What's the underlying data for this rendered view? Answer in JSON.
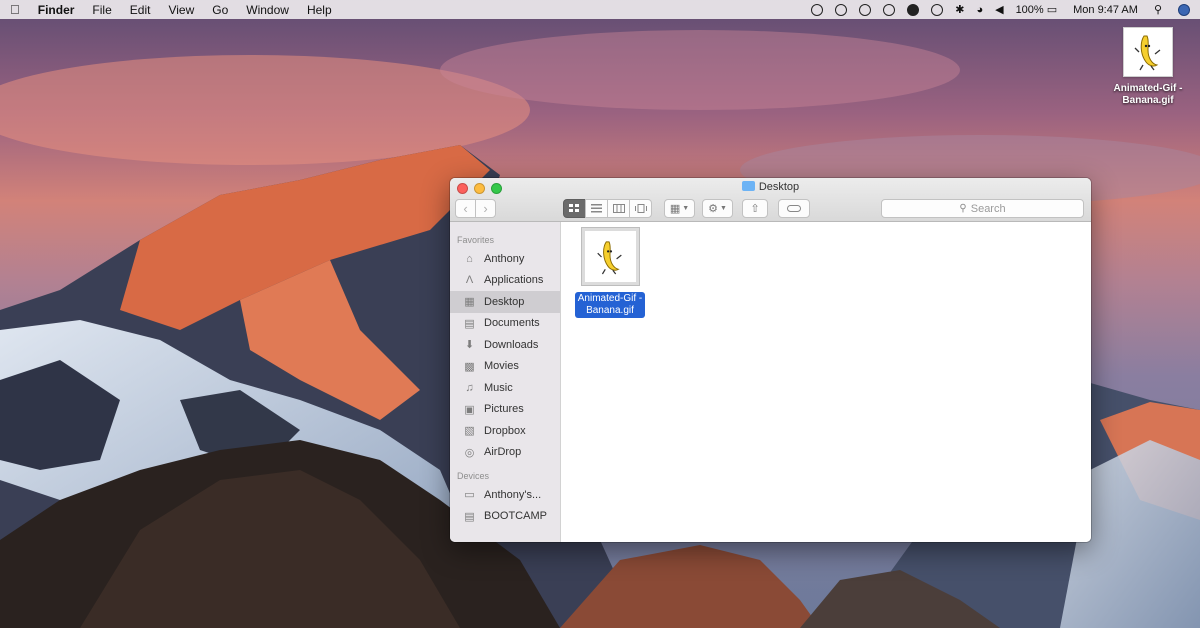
{
  "menubar": {
    "apple_icon": "apple-logo-icon",
    "app_name": "Finder",
    "menus": [
      "File",
      "Edit",
      "View",
      "Go",
      "Window",
      "Help"
    ],
    "battery": "100%",
    "clock": "Mon 9:47 AM",
    "status_icons": [
      "time-machine-icon",
      "sync-icon",
      "mask-icon",
      "vpn-icon",
      "cloud-icon",
      "creative-cloud-icon",
      "bluetooth-icon",
      "wifi-icon",
      "volume-icon",
      "battery-icon",
      "search-icon",
      "avatar-icon"
    ]
  },
  "desktop": {
    "file_name_line1": "Animated-Gif -",
    "file_name_line2": "Banana.gif"
  },
  "finder": {
    "title": "Desktop",
    "search_placeholder": "Search",
    "sidebar": {
      "favorites_header": "Favorites",
      "favorites": [
        {
          "label": "Anthony",
          "icon": "home-icon"
        },
        {
          "label": "Applications",
          "icon": "applications-icon"
        },
        {
          "label": "Desktop",
          "icon": "desktop-icon",
          "selected": true
        },
        {
          "label": "Documents",
          "icon": "documents-icon"
        },
        {
          "label": "Downloads",
          "icon": "downloads-icon"
        },
        {
          "label": "Movies",
          "icon": "movies-icon"
        },
        {
          "label": "Music",
          "icon": "music-icon"
        },
        {
          "label": "Pictures",
          "icon": "pictures-icon"
        },
        {
          "label": "Dropbox",
          "icon": "dropbox-icon"
        },
        {
          "label": "AirDrop",
          "icon": "airdrop-icon"
        }
      ],
      "devices_header": "Devices",
      "devices": [
        {
          "label": "Anthony's...",
          "icon": "computer-icon"
        },
        {
          "label": "BOOTCAMP",
          "icon": "disk-icon"
        }
      ]
    },
    "content": {
      "file_name_line1": "Animated-Gif -",
      "file_name_line2": "Banana.gif"
    }
  },
  "colors": {
    "selection_blue": "#2462d4",
    "close": "#fc605c",
    "minimize": "#fdbc40",
    "zoom": "#34c84a"
  }
}
